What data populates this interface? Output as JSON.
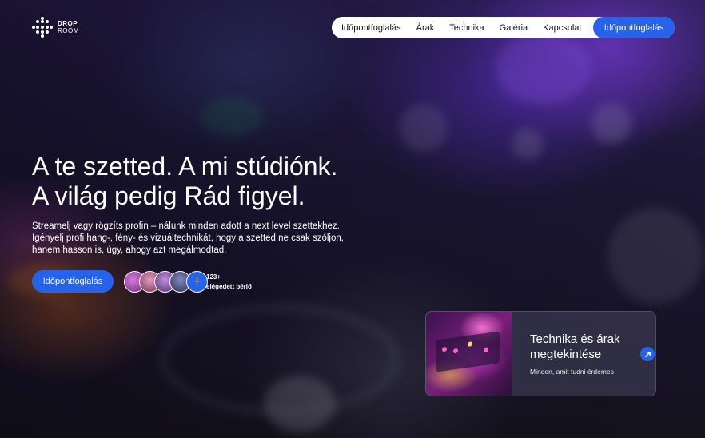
{
  "brand": {
    "line1": "DROP",
    "line2": "ROOM"
  },
  "nav": {
    "items": [
      "Időpontfoglalás",
      "Árak",
      "Technika",
      "Galéria",
      "Kapcsolat"
    ],
    "cta": "Időpontfoglalás"
  },
  "hero": {
    "title_line1": "A te szetted. A mi stúdiónk.",
    "title_line2": "A világ pedig Rád figyel.",
    "description": "Streamelj vagy rögzíts profin – nálunk minden adott a next level szettekhez. Igényelj profi hang-, fény- és vizuáltechnikát, hogy a szetted ne csak szóljon, hanem hasson is, úgy, ahogy azt megálmodtad.",
    "cta": "Időpontfoglalás",
    "renters_count": "123+",
    "renters_label": "elégedett bérlő",
    "add_symbol": "+"
  },
  "card": {
    "title_line1": "Technika és árak",
    "title_line2": "megtekintése",
    "subtitle": "Minden, amit tudni érdemes"
  },
  "colors": {
    "accent": "#2563eb",
    "nav_bg": "#ffffff"
  },
  "icons": [
    "logo-dots-icon",
    "plus-icon",
    "arrow-up-right-icon"
  ]
}
